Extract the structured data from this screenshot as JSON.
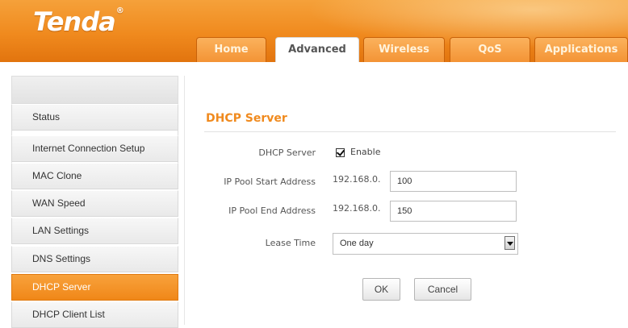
{
  "brand": {
    "logo_text": "Tenda",
    "registered_mark": "®",
    "accent_color": "#f08a1e"
  },
  "nav": {
    "tabs": [
      {
        "label": "Home",
        "active": false
      },
      {
        "label": "Advanced",
        "active": true
      },
      {
        "label": "Wireless",
        "active": false
      },
      {
        "label": "QoS",
        "active": false
      },
      {
        "label": "Applications",
        "active": false
      }
    ]
  },
  "sidebar": {
    "items": [
      {
        "label": "Status"
      },
      {
        "label": "Internet Connection Setup"
      },
      {
        "label": "MAC Clone"
      },
      {
        "label": "WAN Speed"
      },
      {
        "label": "LAN Settings"
      },
      {
        "label": "DNS Settings"
      },
      {
        "label": "DHCP Server",
        "active": true
      },
      {
        "label": "DHCP Client List"
      }
    ]
  },
  "content": {
    "title": "DHCP Server",
    "dhcp_server": {
      "label": "DHCP Server",
      "checkbox_label": "Enable",
      "checked": true
    },
    "pool_start": {
      "label": "IP Pool Start Address",
      "prefix": "192.168.0.",
      "value": "100"
    },
    "pool_end": {
      "label": "IP Pool End Address",
      "prefix": "192.168.0.",
      "value": "150"
    },
    "lease_time": {
      "label": "Lease Time",
      "selected": "One day"
    },
    "ok_label": "OK",
    "cancel_label": "Cancel"
  }
}
